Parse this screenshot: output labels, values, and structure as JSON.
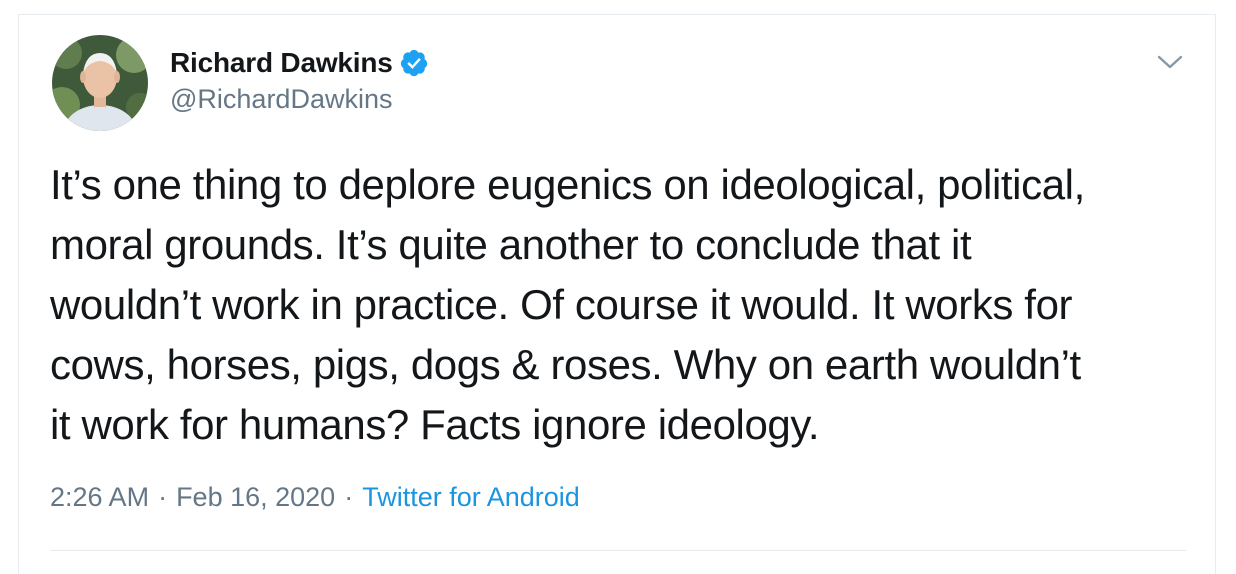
{
  "tweet": {
    "author": {
      "name": "Richard Dawkins",
      "handle": "@RichardDawkins",
      "verified": true,
      "avatar": "profile-photo"
    },
    "text_lines": [
      "It’s one thing to deplore eugenics on ideological, political,",
      "moral grounds. It’s quite another to conclude that it",
      "wouldn’t work in practice. Of course it would. It works for",
      "cows, horses, pigs, dogs & roses. Why on earth wouldn’t",
      "it work for humans? Facts ignore ideology."
    ],
    "time": "2:26 AM",
    "separator": "·",
    "date": "Feb 16, 2020",
    "source": "Twitter for Android",
    "menu_icon": "chevron-down-icon"
  },
  "colors": {
    "text": "#14171a",
    "secondary": "#657786",
    "accent": "#1b95e0",
    "border": "#e6ecf0"
  }
}
